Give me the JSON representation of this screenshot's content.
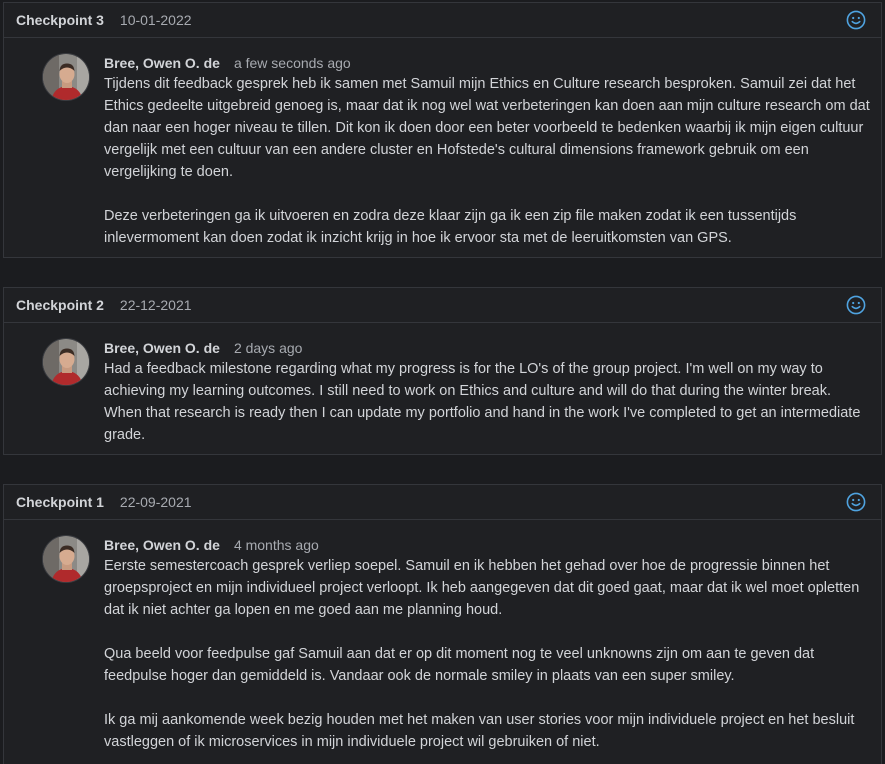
{
  "checkpoints": [
    {
      "title": "Checkpoint 3",
      "date": "10-01-2022",
      "icon": "smiley-icon",
      "author": "Bree, Owen O. de",
      "time": "a few seconds ago",
      "paragraphs": [
        "Tijdens dit feedback gesprek heb ik samen met Samuil mijn Ethics en Culture research besproken. Samuil zei dat het Ethics gedeelte uitgebreid genoeg is, maar dat ik nog wel wat verbeteringen kan doen aan mijn culture research om dat dan naar een hoger niveau te tillen. Dit kon ik doen door een beter voorbeeld te bedenken waarbij ik mijn eigen cultuur vergelijk met een cultuur van een andere cluster en Hofstede's cultural dimensions framework gebruik om een vergelijking te doen.",
        "Deze verbeteringen ga ik uitvoeren en zodra deze klaar zijn ga ik een zip file maken zodat ik een tussentijds inlevermoment kan doen zodat ik inzicht krijg in hoe ik ervoor sta met de leeruitkomsten van GPS."
      ]
    },
    {
      "title": "Checkpoint 2",
      "date": "22-12-2021",
      "icon": "smiley-icon",
      "author": "Bree, Owen O. de",
      "time": "2 days ago",
      "paragraphs": [
        "Had a feedback milestone regarding what my progress is for the LO's of the group project. I'm well on my way to achieving my learning outcomes. I still need to work on Ethics and culture and will do that during the winter break. When that research is ready then I can update my portfolio and hand in the work I've completed to get an intermediate grade."
      ]
    },
    {
      "title": "Checkpoint 1",
      "date": "22-09-2021",
      "icon": "smiley-icon",
      "author": "Bree, Owen O. de",
      "time": "4 months ago",
      "paragraphs": [
        "Eerste semestercoach gesprek verliep soepel. Samuil en ik hebben het gehad over hoe de progressie binnen het groepsproject en mijn individueel project verloopt. Ik heb aangegeven dat dit goed gaat, maar dat ik wel moet opletten dat ik niet achter ga lopen en me goed aan me planning houd.",
        "Qua beeld voor feedpulse gaf Samuil aan dat er op dit moment nog te veel unknowns zijn om aan te geven dat feedpulse hoger dan gemiddeld is. Vandaar ook de normale smiley in plaats van een super smiley.",
        "Ik ga mij aankomende week bezig houden met het maken van user stories voor mijn individuele project en het besluit vastleggen of ik microservices in mijn individuele project wil gebruiken of niet."
      ]
    }
  ],
  "colors": {
    "background": "#1b1c1f",
    "card": "#1f2023",
    "border": "#34363b",
    "text": "#d2d4d8",
    "muted": "#a7aab0",
    "smiley": "#4fa3e0"
  }
}
